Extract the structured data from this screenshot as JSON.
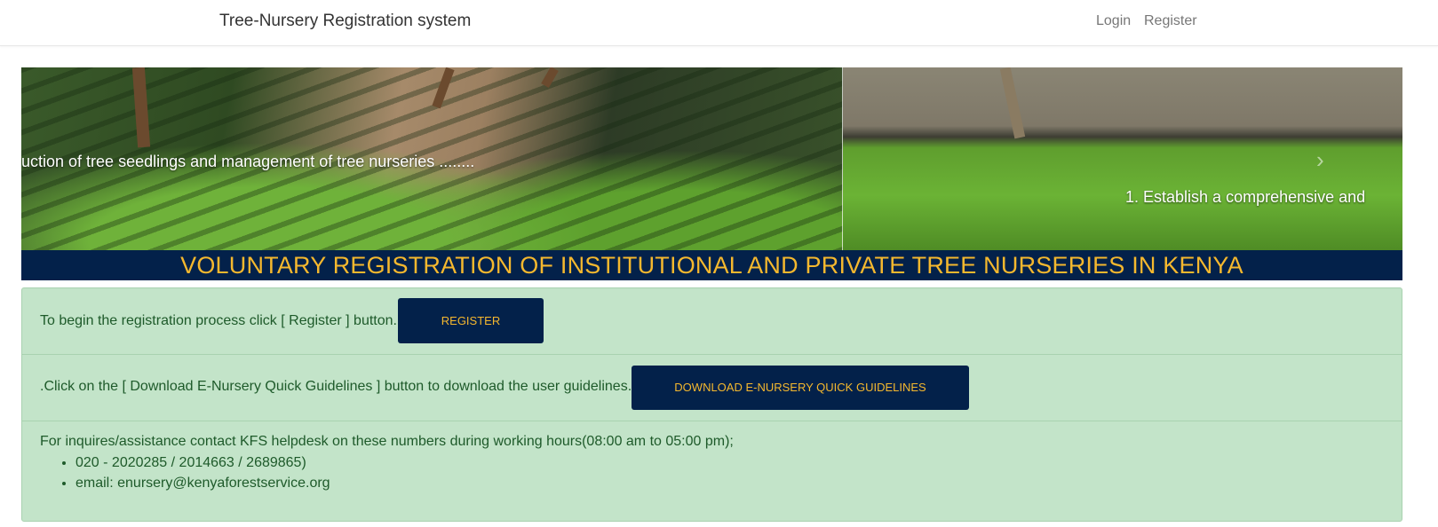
{
  "navbar": {
    "brand": "Tree-Nursery Registration system",
    "login_label": "Login",
    "register_label": "Register"
  },
  "carousel": {
    "caption_left": "uction of tree seedlings and management of tree nurseries ........",
    "caption_right": "1. Establish a comprehensive and",
    "next_icon": "chevron-right-icon"
  },
  "title_bar": {
    "text": "VOLUNTARY REGISTRATION OF INSTITUTIONAL AND PRIVATE TREE NURSERIES IN KENYA"
  },
  "panel": {
    "register_instruction": "To begin the registration process click [ Register ] button.",
    "register_button": "REGISTER",
    "download_instruction": ".Click on the [ Download E-Nursery Quick Guidelines ] button to download the user guidelines.",
    "download_button": "DOWNLOAD E-NURSERY QUICK GUIDELINES",
    "contact_intro": "For inquires/assistance contact KFS helpdesk on these numbers during working hours(08:00 am to 05:00 pm);",
    "contact_items": [
      "020 - 2020285 / 2014663 / 2689865)",
      "email: enursery@kenyaforestservice.org"
    ]
  },
  "colors": {
    "navy": "#03214a",
    "gold": "#f5b82e",
    "panel_green": "#c3e4c9",
    "text_green": "#1e5a2a"
  }
}
